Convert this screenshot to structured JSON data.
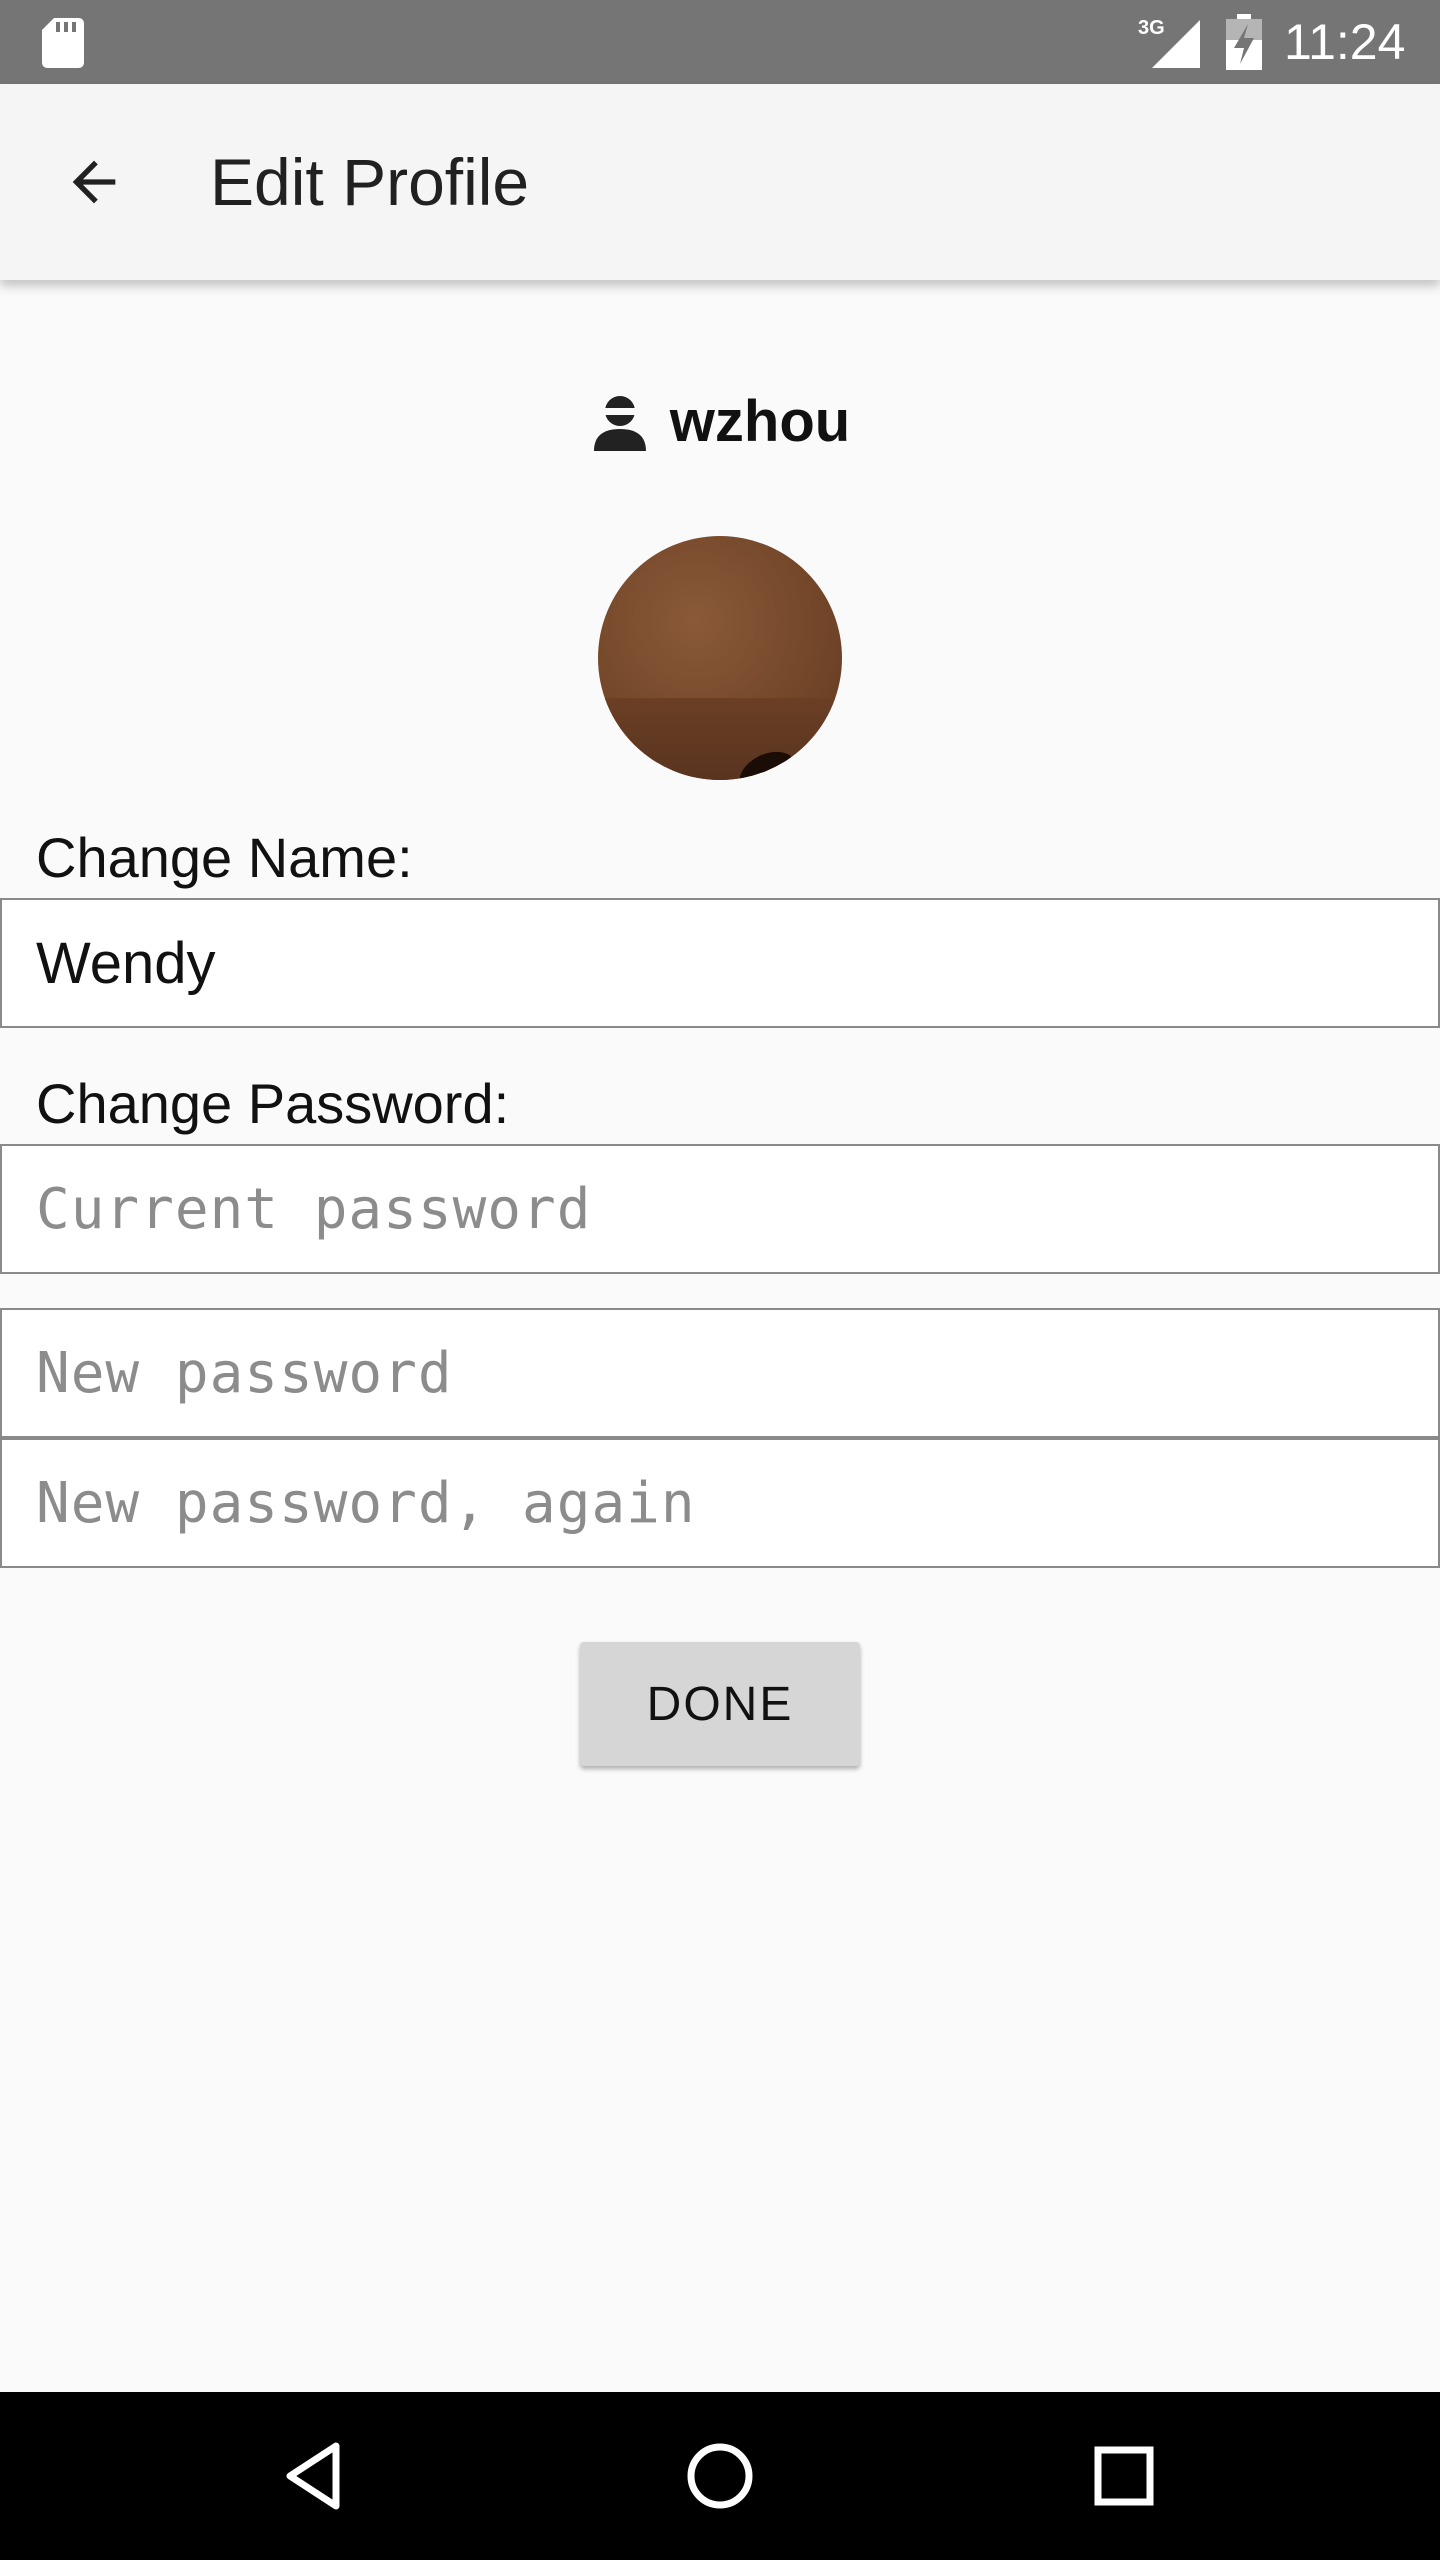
{
  "status_bar": {
    "time": "11:24",
    "network": "3G",
    "icons": [
      "sd-card-icon",
      "signal-icon",
      "battery-charging-icon"
    ]
  },
  "app_bar": {
    "title": "Edit Profile",
    "back_icon": "arrow-back-icon"
  },
  "profile": {
    "username": "wzhou",
    "user_icon": "person-icon"
  },
  "name_section": {
    "label": "Change Name:",
    "value": "Wendy"
  },
  "password_section": {
    "label": "Change Password:",
    "current_placeholder": "Current password",
    "new_placeholder": "New password",
    "confirm_placeholder": "New password, again"
  },
  "actions": {
    "done_label": "DONE"
  },
  "nav_bar": {
    "icons": [
      "back-triangle-icon",
      "home-circle-icon",
      "recents-square-icon"
    ]
  },
  "colors": {
    "status_bar": "#757575",
    "app_bar": "#f5f5f5",
    "background": "#fafafa",
    "button": "#d6d6d6",
    "nav_bar": "#000000"
  }
}
